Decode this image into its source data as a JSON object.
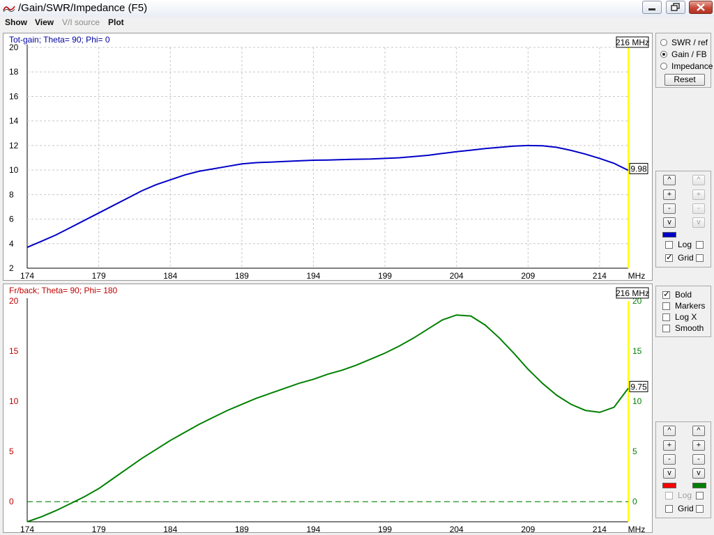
{
  "window": {
    "title": "/Gain/SWR/Impedance (F5)",
    "icon": "antenna-app-icon"
  },
  "menu": [
    {
      "label": "Show",
      "enabled": true
    },
    {
      "label": "View",
      "enabled": true
    },
    {
      "label": "V/I source",
      "enabled": false
    },
    {
      "label": "Plot",
      "enabled": true
    }
  ],
  "colors": {
    "gain_line": "#0000c8",
    "fb_line": "#008000",
    "fb_axis_left": "#c00000",
    "cursor": "#ffff00",
    "grid": "#c8c8c8"
  },
  "chart_data": [
    {
      "type": "line",
      "title": "Tot-gain; Theta= 90; Phi= 0",
      "xlabel": "MHz",
      "xlim": [
        174,
        216
      ],
      "ylim": [
        2,
        20
      ],
      "xticks": [
        174,
        179,
        184,
        189,
        194,
        199,
        204,
        209,
        214
      ],
      "yticks": [
        2,
        4,
        6,
        8,
        10,
        12,
        14,
        16,
        18,
        20
      ],
      "grid": true,
      "cursor_label": "216 MHz",
      "cursor_value_label": "9.98",
      "series": [
        {
          "x": [
            174,
            175,
            176,
            177,
            178,
            179,
            180,
            181,
            182,
            183,
            184,
            185,
            186,
            187,
            188,
            189,
            190,
            191,
            192,
            193,
            194,
            195,
            196,
            197,
            198,
            199,
            200,
            201,
            202,
            203,
            204,
            205,
            206,
            207,
            208,
            209,
            210,
            211,
            212,
            213,
            214,
            215,
            216
          ],
          "y": [
            3.7,
            4.2,
            4.7,
            5.3,
            5.9,
            6.5,
            7.1,
            7.7,
            8.3,
            8.8,
            9.2,
            9.6,
            9.9,
            10.1,
            10.3,
            10.5,
            10.6,
            10.65,
            10.7,
            10.75,
            10.8,
            10.82,
            10.85,
            10.88,
            10.9,
            10.95,
            11.0,
            11.1,
            11.2,
            11.35,
            11.5,
            11.62,
            11.75,
            11.85,
            11.95,
            12.0,
            11.98,
            11.85,
            11.6,
            11.3,
            10.95,
            10.55,
            9.98
          ]
        }
      ]
    },
    {
      "type": "line",
      "title": "Fr/back; Theta= 90; Phi= 180",
      "xlabel": "MHz",
      "xlim": [
        174,
        216
      ],
      "ylim": [
        -2,
        20
      ],
      "xticks": [
        174,
        179,
        184,
        189,
        194,
        199,
        204,
        209,
        214
      ],
      "yticks_left": [
        0,
        5,
        10,
        15,
        20
      ],
      "yticks_right": [
        0,
        5,
        10,
        15,
        20
      ],
      "grid": false,
      "cursor_label": "216 MHz",
      "cursor_value_label": "9.75",
      "series": [
        {
          "x": [
            174,
            175,
            176,
            177,
            178,
            179,
            180,
            181,
            182,
            183,
            184,
            185,
            186,
            187,
            188,
            189,
            190,
            191,
            192,
            193,
            194,
            195,
            196,
            197,
            198,
            199,
            200,
            201,
            202,
            203,
            204,
            205,
            206,
            207,
            208,
            209,
            210,
            211,
            212,
            213,
            214,
            215,
            216
          ],
          "y": [
            -2.0,
            -1.5,
            -0.9,
            -0.2,
            0.5,
            1.3,
            2.3,
            3.3,
            4.3,
            5.2,
            6.1,
            6.9,
            7.7,
            8.4,
            9.1,
            9.7,
            10.3,
            10.8,
            11.3,
            11.8,
            12.2,
            12.7,
            13.1,
            13.6,
            14.2,
            14.8,
            15.5,
            16.3,
            17.2,
            18.1,
            18.6,
            18.5,
            17.6,
            16.3,
            14.8,
            13.2,
            11.8,
            10.6,
            9.7,
            9.1,
            8.9,
            9.4,
            11.3
          ]
        },
        {
          "name": "",
          "x": [
            174,
            216
          ],
          "y": [
            0,
            0
          ],
          "style": "dashed"
        }
      ]
    }
  ],
  "side_panel_top": {
    "radios": [
      {
        "label": "SWR / ref",
        "checked": false
      },
      {
        "label": "Gain / FB",
        "checked": true
      },
      {
        "label": "Impedance",
        "checked": false
      }
    ],
    "reset_label": "Reset"
  },
  "scale_panel_1": {
    "buttons": [
      "^",
      "+",
      "-",
      "v"
    ],
    "swatch_left": "#0000c8",
    "log_label": "Log",
    "log_checked": false,
    "grid_label": "Grid",
    "grid_checked": true,
    "right_log_checked": false,
    "right_grid_checked": false
  },
  "options_panel": {
    "items": [
      {
        "label": "Bold",
        "checked": true
      },
      {
        "label": "Markers",
        "checked": false
      },
      {
        "label": "Log X",
        "checked": false
      },
      {
        "label": "Smooth",
        "checked": false
      }
    ]
  },
  "scale_panel_2": {
    "buttons": [
      "^",
      "+",
      "-",
      "v"
    ],
    "swatch_left": "#ff0000",
    "swatch_right": "#008000",
    "log_label": "Log",
    "log_checked": false,
    "grid_label": "Grid",
    "grid_checked": false,
    "right_log_checked": false,
    "right_grid_checked": false
  }
}
